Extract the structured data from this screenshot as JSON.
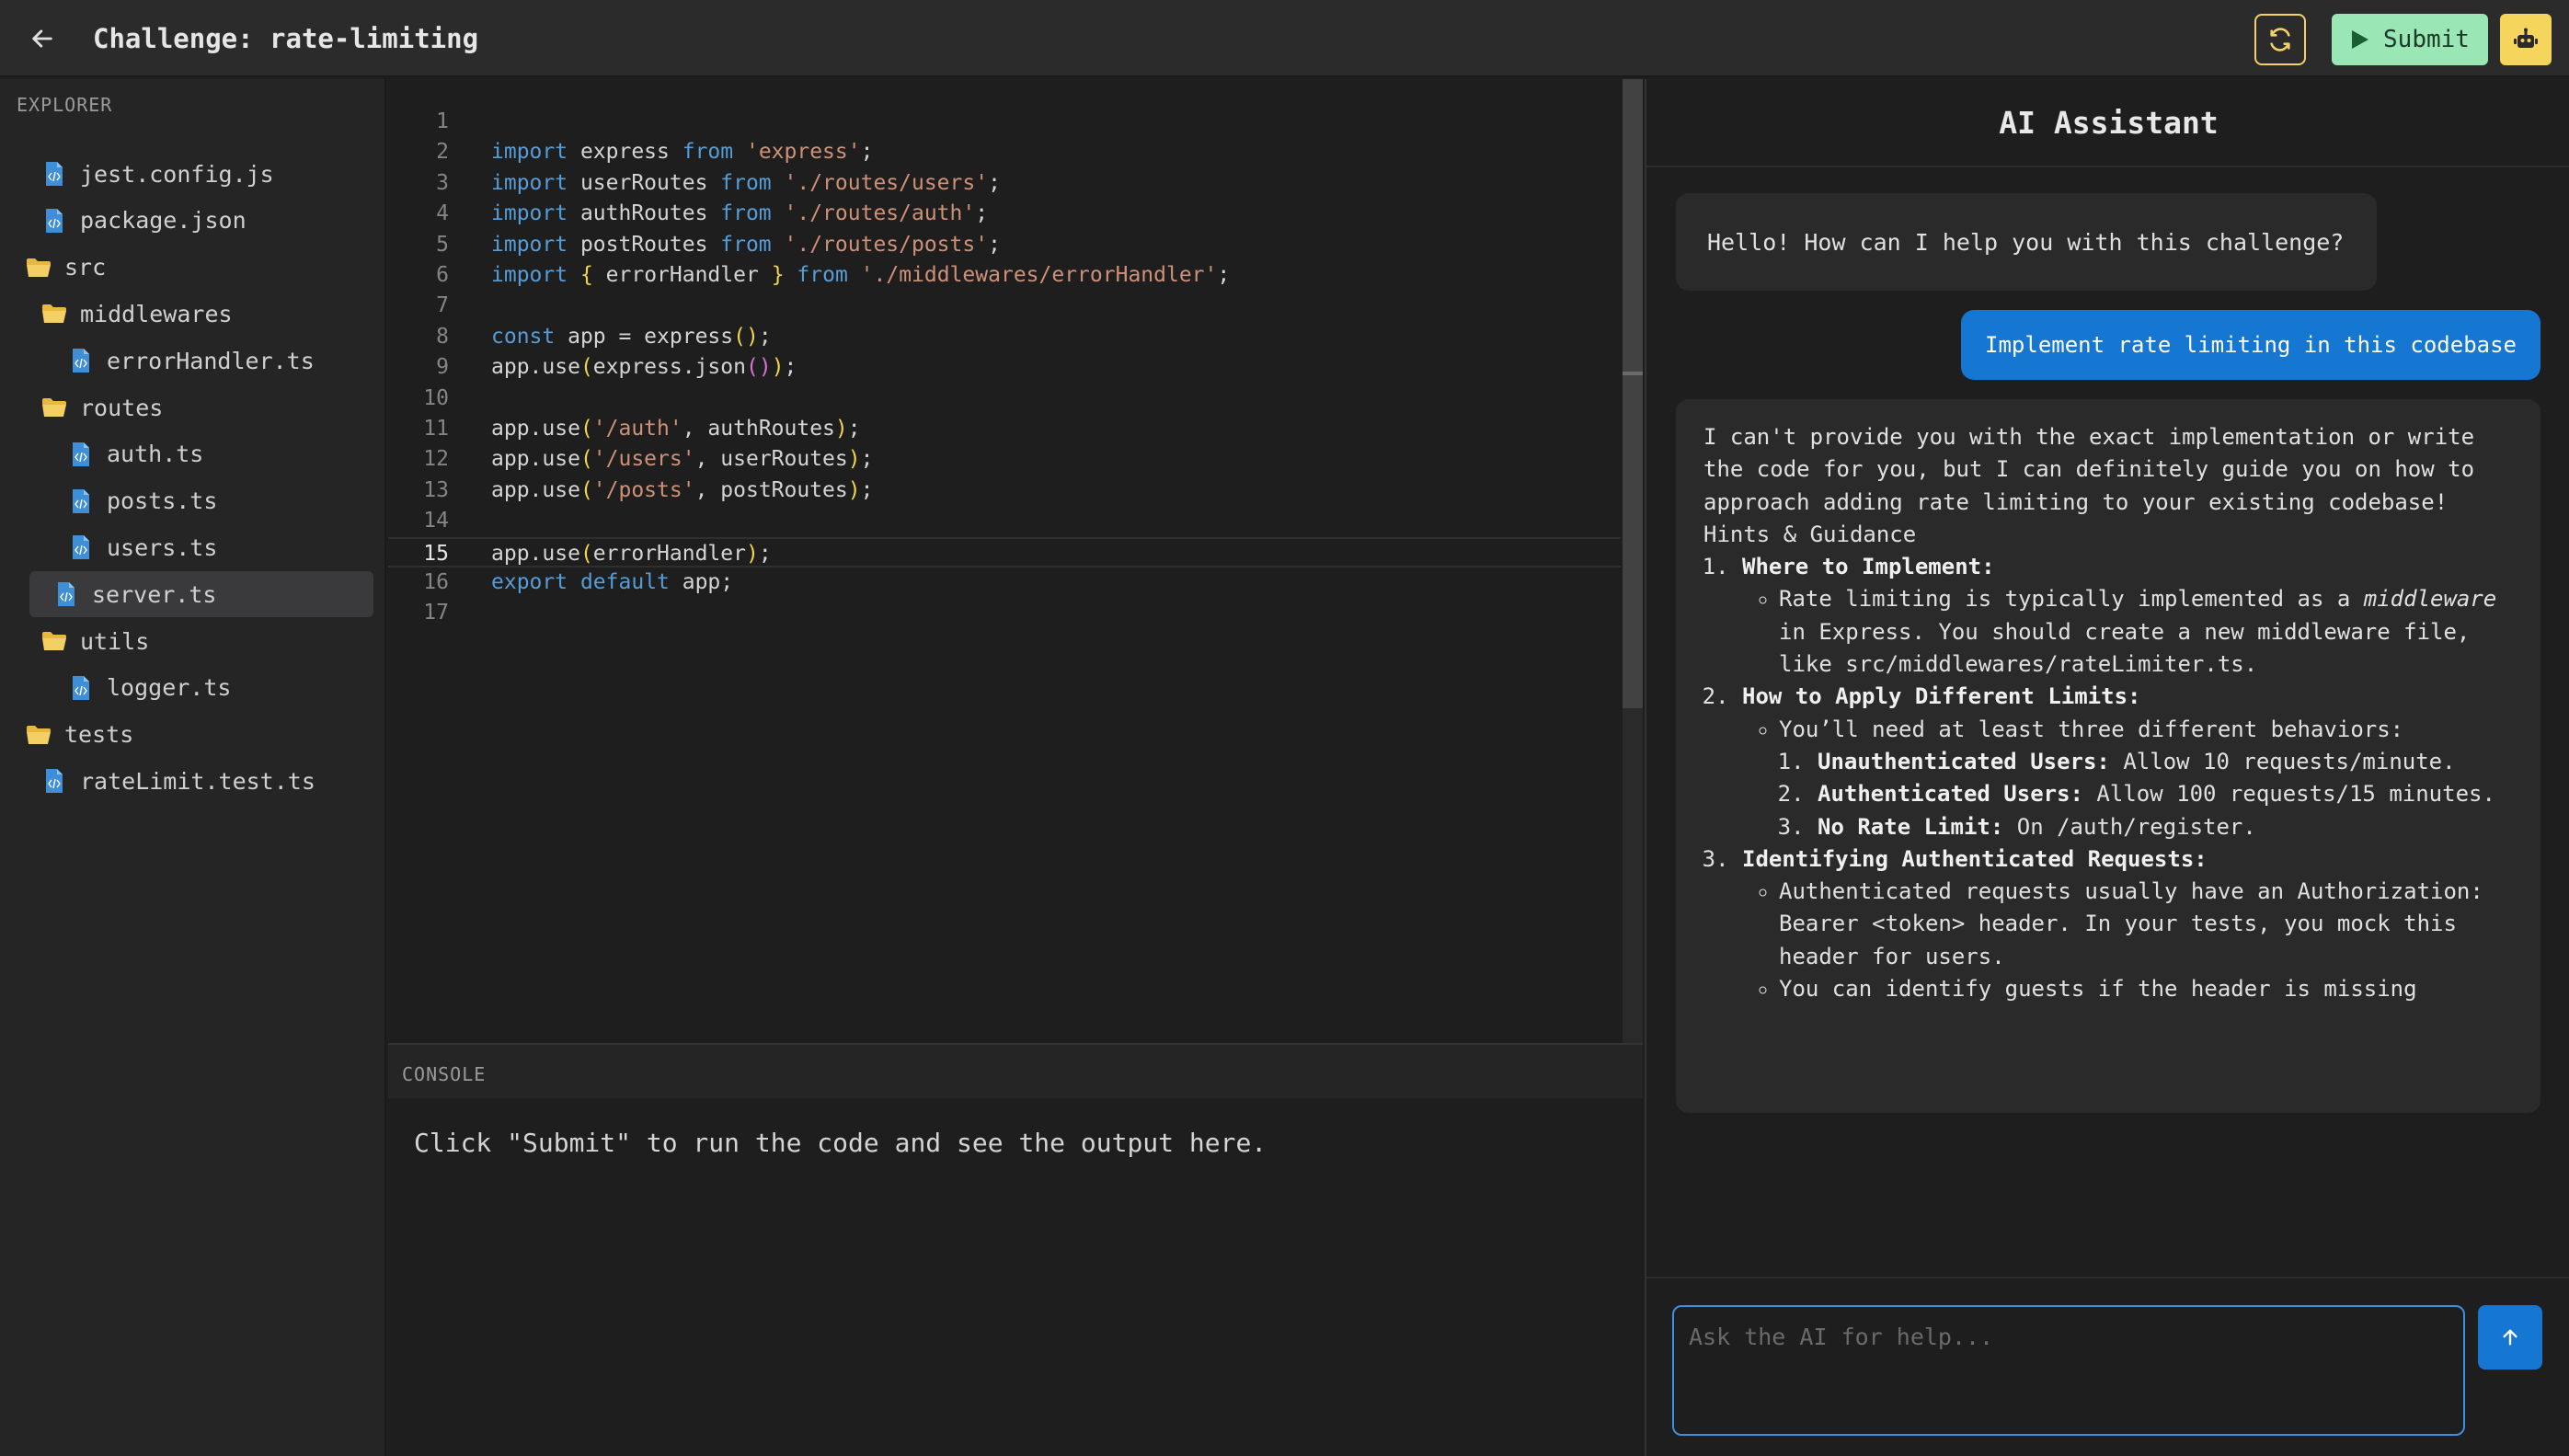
{
  "header": {
    "title": "Challenge: rate-limiting",
    "submit_label": "Submit",
    "back_icon": "arrow-left-icon",
    "refresh_icon": "refresh-icon",
    "bot_icon": "robot-icon"
  },
  "explorer": {
    "title": "EXPLORER",
    "items": [
      {
        "name": "jest.config.js",
        "type": "file"
      },
      {
        "name": "package.json",
        "type": "file"
      },
      {
        "name": "src",
        "type": "folder"
      },
      {
        "name": "middlewares",
        "type": "folder"
      },
      {
        "name": "errorHandler.ts",
        "type": "file"
      },
      {
        "name": "routes",
        "type": "folder"
      },
      {
        "name": "auth.ts",
        "type": "file"
      },
      {
        "name": "posts.ts",
        "type": "file"
      },
      {
        "name": "users.ts",
        "type": "file"
      },
      {
        "name": "server.ts",
        "type": "file",
        "active": true
      },
      {
        "name": "utils",
        "type": "folder"
      },
      {
        "name": "logger.ts",
        "type": "file"
      },
      {
        "name": "tests",
        "type": "folder"
      },
      {
        "name": "rateLimit.test.ts",
        "type": "file"
      }
    ]
  },
  "editor": {
    "current_line": 15,
    "lines": [
      "",
      "import express from 'express';",
      "import userRoutes from './routes/users';",
      "import authRoutes from './routes/auth';",
      "import postRoutes from './routes/posts';",
      "import { errorHandler } from './middlewares/errorHandler';",
      "",
      "const app = express();",
      "app.use(express.json());",
      "",
      "app.use('/auth', authRoutes);",
      "app.use('/users', userRoutes);",
      "app.use('/posts', postRoutes);",
      "",
      "app.use(errorHandler);",
      "export default app;",
      ""
    ]
  },
  "console": {
    "title": "CONSOLE",
    "message": "Click \"Submit\" to run the code and see the output here."
  },
  "assistant": {
    "title": "AI Assistant",
    "greeting": "Hello! How can I help you with this challenge?",
    "user_message": "Implement rate limiting in this codebase",
    "reply": {
      "intro": "I can't provide you with the exact implementation or write the code for you, but I can definitely guide you on how to approach adding rate limiting to your existing codebase!",
      "hints_title": "Hints & Guidance",
      "s1_title": "Where to Implement:",
      "s1_b1_pre": "Rate limiting is typically implemented as a ",
      "s1_b1_em": "middleware",
      "s1_b1_post": " in Express. You should create a new middleware file, like src/middlewares/rateLimiter.ts.",
      "s2_title": "How to Apply Different Limits:",
      "s2_b1": "You’ll need at least three different behaviors:",
      "s2_l1_b": "Unauthenticated Users:",
      "s2_l1_t": " Allow 10 requests/minute.",
      "s2_l2_b": "Authenticated Users:",
      "s2_l2_t": " Allow 100 requests/15 minutes.",
      "s2_l3_b": "No Rate Limit:",
      "s2_l3_t": " On /auth/register.",
      "s3_title": "Identifying Authenticated Requests:",
      "s3_b1": "Authenticated requests usually have an Authorization: Bearer <token> header. In your tests, you mock this header for users.",
      "s3_b2": "You can identify guests if the header is missing"
    },
    "input_placeholder": "Ask the AI for help...",
    "send_icon": "arrow-up-icon"
  }
}
